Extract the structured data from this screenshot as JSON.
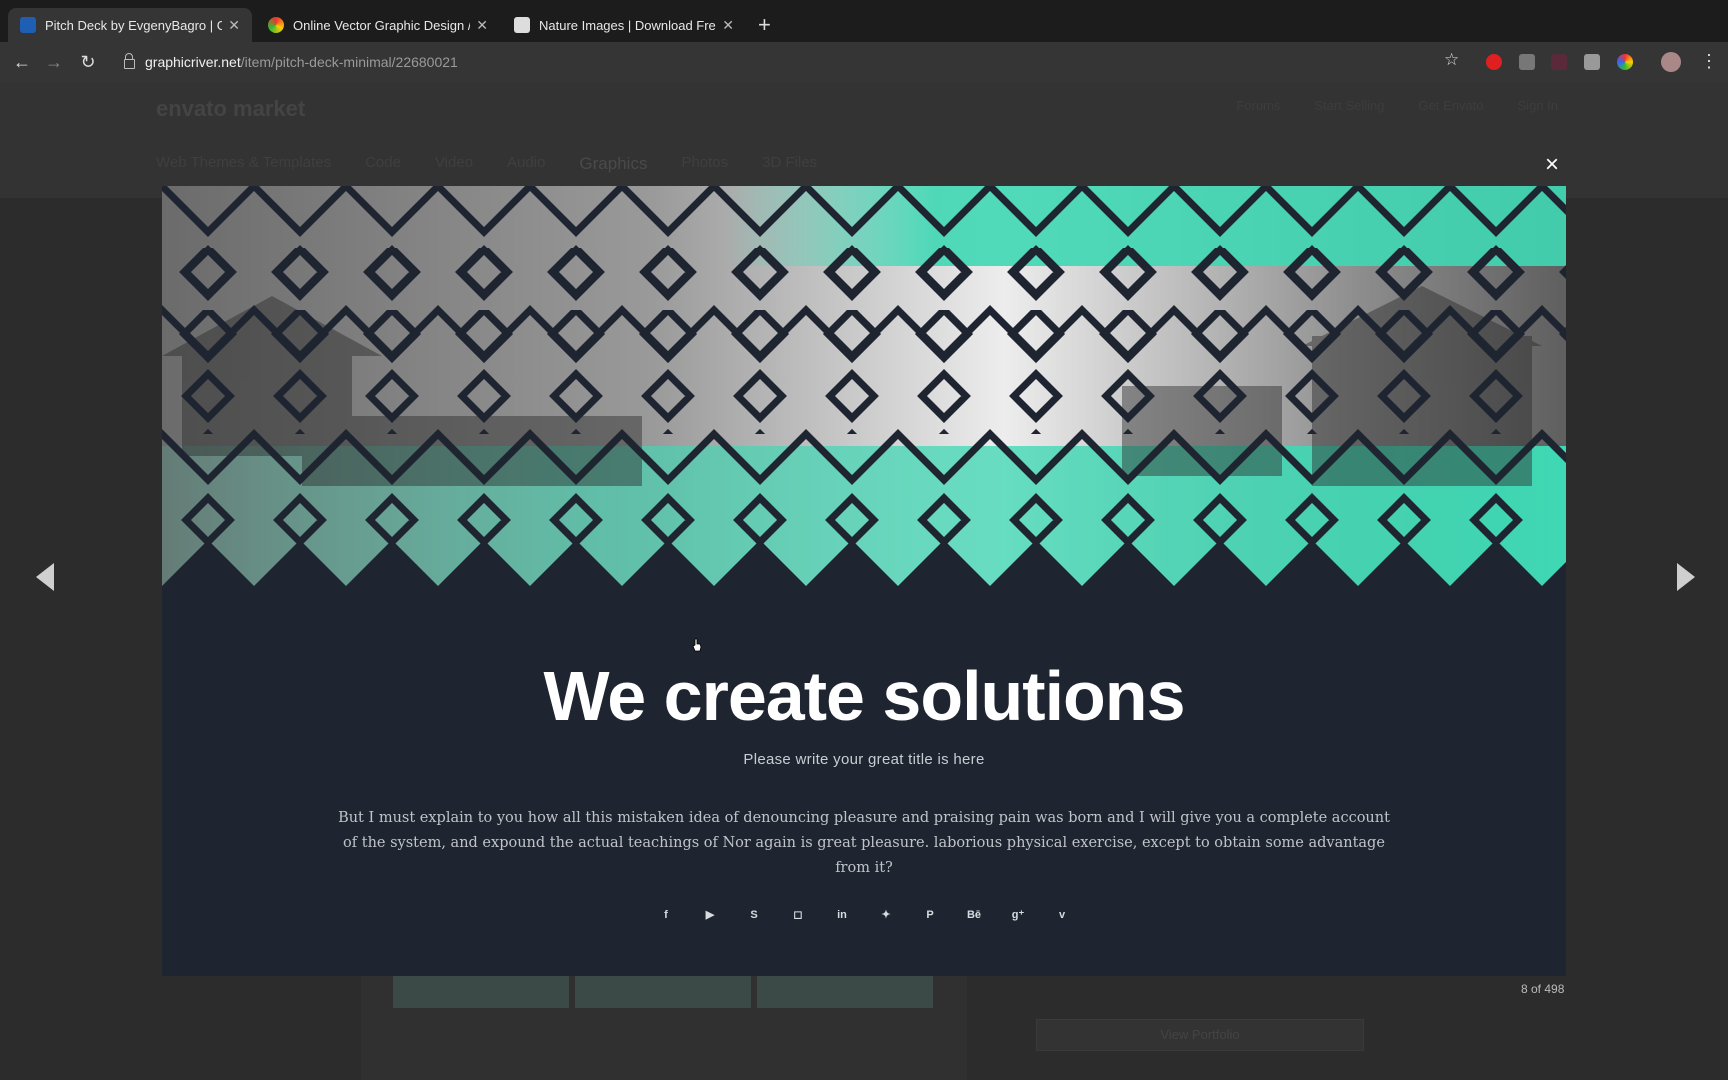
{
  "browser": {
    "tabs": [
      {
        "title": "Pitch Deck by EvgenyBagro | G",
        "favicon": "envato-leaf-icon",
        "active": true
      },
      {
        "title": "Online Vector Graphic Design /",
        "favicon": "colorful-circle-icon",
        "active": false
      },
      {
        "title": "Nature Images | Download Fre",
        "favicon": "camera-icon",
        "active": false
      }
    ],
    "new_tab": "+",
    "url_host": "graphicriver.net",
    "url_path": "/item/pitch-deck-minimal/22680021"
  },
  "background_page": {
    "logo": "envato market",
    "top_links": [
      "Forums",
      "Start Selling",
      "Get Envato",
      "Sign In"
    ],
    "nav": [
      "Web Themes & Templates",
      "Code",
      "Video",
      "Audio",
      "Graphics",
      "Photos",
      "3D Files"
    ],
    "portfolio_button": "View Portfolio"
  },
  "lightbox": {
    "close": "×",
    "counter": "8 of 498",
    "slide": {
      "title": "We create solutions",
      "subtitle": "Please write your great title is here",
      "body": "But I must explain to you how all this mistaken idea of denouncing pleasure and praising pain was born and I will give you a complete account of the system, and expound the actual teachings of Nor again is great pleasure. laborious physical exercise, except to obtain some advantage from it?",
      "social_icons": [
        {
          "name": "facebook-icon",
          "glyph": "f"
        },
        {
          "name": "youtube-icon",
          "glyph": "▶"
        },
        {
          "name": "skype-icon",
          "glyph": "S"
        },
        {
          "name": "instagram-icon",
          "glyph": "◻"
        },
        {
          "name": "linkedin-icon",
          "glyph": "in"
        },
        {
          "name": "twitter-icon",
          "glyph": "✦"
        },
        {
          "name": "pinterest-icon",
          "glyph": "P"
        },
        {
          "name": "behance-icon",
          "glyph": "Bē"
        },
        {
          "name": "google-plus-icon",
          "glyph": "g⁺"
        },
        {
          "name": "vimeo-icon",
          "glyph": "v"
        }
      ]
    }
  },
  "colors": {
    "slide_bg": "#1e2530",
    "teal": "#3fd8b4",
    "chrome_dark": "#1c1c1c",
    "chrome_toolbar": "#353535"
  }
}
